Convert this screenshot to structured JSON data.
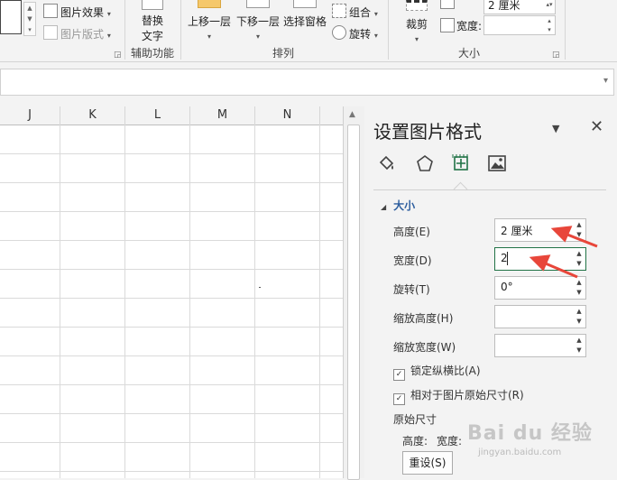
{
  "ribbon": {
    "picture_effects": "图片效果",
    "picture_layout": "图片版式",
    "alt_text_line1": "替换",
    "alt_text_line2": "文字",
    "group_accessibility": "辅助功能",
    "bring_forward": "上移一层",
    "send_backward": "下移一层",
    "selection_pane": "选择窗格",
    "group": "组合",
    "rotate": "旋转",
    "group_arrange": "排列",
    "crop": "裁剪",
    "height_value": "2 厘米",
    "width_label": "宽度:",
    "group_size": "大小"
  },
  "sheet": {
    "columns": [
      "J",
      "K",
      "L",
      "M",
      "N"
    ]
  },
  "pane": {
    "title": "设置图片格式",
    "section_size": "大小",
    "height_label": "高度(E)",
    "height_value": "2 厘米",
    "width_label": "宽度(D)",
    "width_value": "2",
    "rotation_label": "旋转(T)",
    "rotation_value": "0°",
    "scale_height_label": "缩放高度(H)",
    "scale_height_value": "",
    "scale_width_label": "缩放宽度(W)",
    "scale_width_value": "",
    "lock_aspect_label": "锁定纵横比(A)",
    "relative_label": "相对于图片原始尺寸(R)",
    "original_size_label": "原始尺寸",
    "orig_height_label": "高度:",
    "orig_width_label": "宽度:",
    "reset_label": "重设(S)"
  },
  "watermark": {
    "text": "Bai du 经验",
    "url": "jingyan.baidu.com"
  },
  "colors": {
    "accent": "#217346",
    "section": "#2d5e9e",
    "arrow": "#e8463a"
  }
}
